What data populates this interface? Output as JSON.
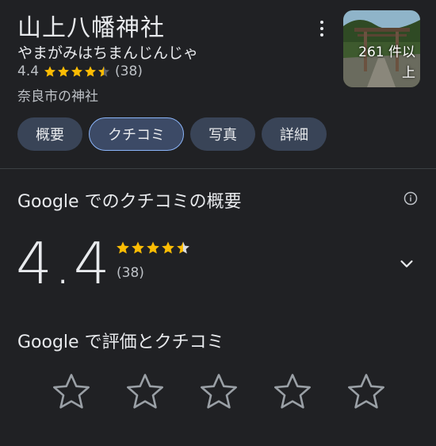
{
  "place": {
    "name": "山上八幡神社",
    "reading": "やまがみはちまんじんじゃ",
    "rating": "4.4",
    "review_count": "(38)",
    "category": "奈良市の神社",
    "photo_count": "261 件以上"
  },
  "tabs": [
    {
      "label": "概要"
    },
    {
      "label": "クチコミ"
    },
    {
      "label": "写真"
    },
    {
      "label": "詳細"
    }
  ],
  "review_summary": {
    "title": "Google でのクチコミの概要",
    "rating": "4.4",
    "count": "(38)"
  },
  "rate_section": {
    "title": "Google で評価とクチコミ"
  },
  "colors": {
    "background": "#202124",
    "star_fill": "#fbbc04",
    "tab_bg": "#394457",
    "active_border": "#8ab4f8"
  }
}
